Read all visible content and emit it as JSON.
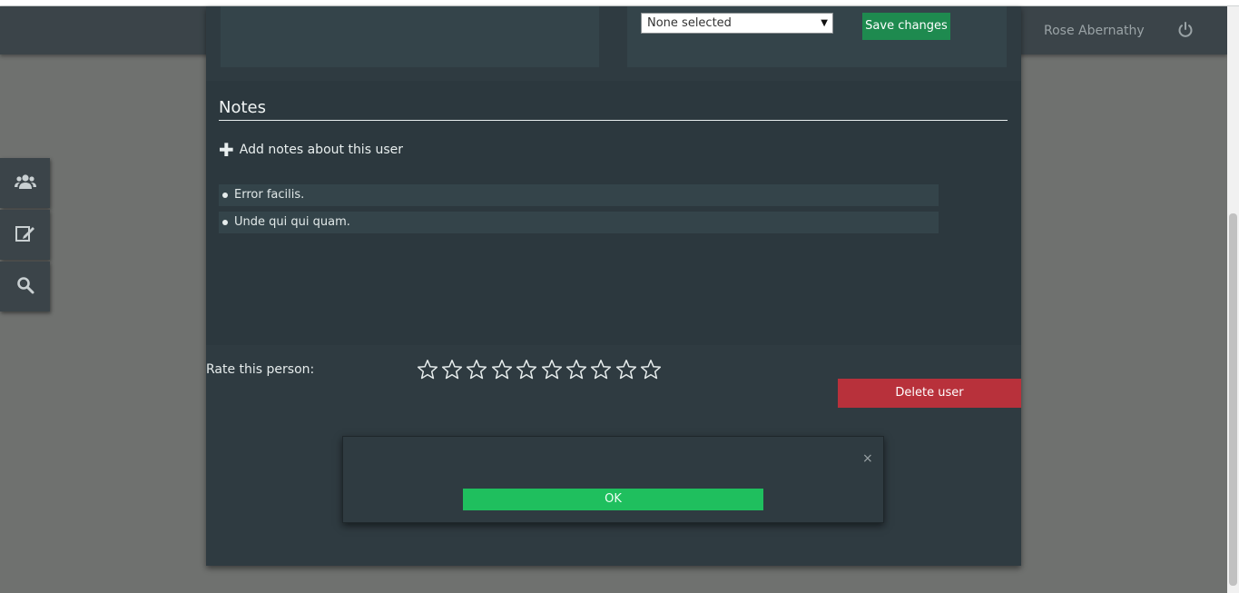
{
  "header": {
    "username": "Rose Abernathy",
    "power_icon": "power-icon"
  },
  "sidebar": {
    "items": [
      {
        "icon": "users-icon"
      },
      {
        "icon": "edit-icon"
      },
      {
        "icon": "search-icon"
      }
    ]
  },
  "form": {
    "select_value": "None selected",
    "save_label": "Save changes"
  },
  "notes": {
    "title": "Notes",
    "add_label": "Add notes about this user",
    "items": [
      "Error facilis.",
      "Unde qui qui quam."
    ]
  },
  "rating": {
    "label": "Rate this person:",
    "max": 10,
    "value": 0
  },
  "actions": {
    "delete_label": "Delete user"
  },
  "modal": {
    "close_label": "×",
    "ok_label": "OK"
  },
  "colors": {
    "accent_green": "#1e8a4f",
    "ok_green": "#1fbf5e",
    "danger": "#b8313b"
  }
}
